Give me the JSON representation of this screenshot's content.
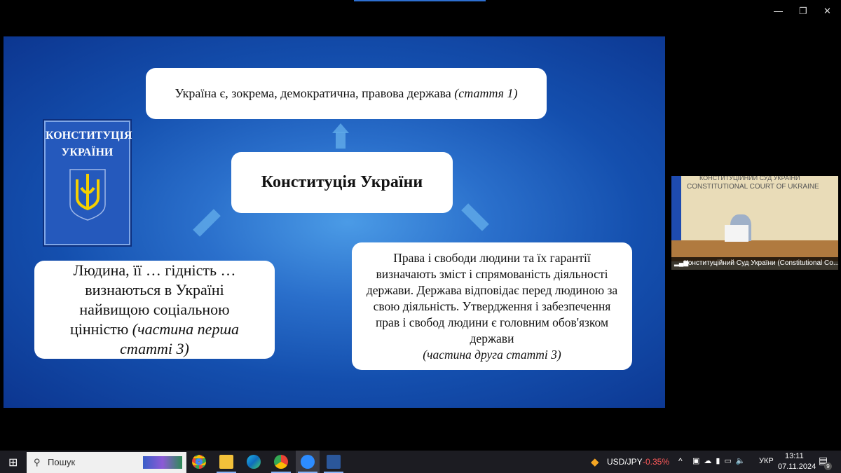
{
  "window": {
    "minimize": "—",
    "restore": "❐",
    "close": "✕"
  },
  "slide": {
    "top_box": {
      "text": "Україна є, зокрема, демократична, правова держава ",
      "ref": "(стаття 1)"
    },
    "center_box": "Конституція України",
    "left_box": {
      "text": "Людина, її … гідність … визнаються в Україні найвищою соціальною цінністю ",
      "ref": "(частина перша статті 3)"
    },
    "right_box": {
      "text": "Права і свободи людини та їх гарантії визначають зміст і спрямованість діяльності держави. Держава відповідає перед людиною за свою діяльність. Утвердження і забезпечення прав і свобод людини є головним обов'язком держави",
      "ref": "(частина друга статті 3)"
    },
    "book": {
      "title1": "КОНСТИТУЦІЯ",
      "title2": "УКРАЇНИ"
    }
  },
  "video": {
    "wall_title1": "КОНСТИТУЦІЙНИЙ СУД УКРАЇНИ",
    "wall_title2": "CONSTITUTIONAL COURT OF UKRAINE",
    "participant": "Конституційний Суд України (Constitutional Co..."
  },
  "taskbar": {
    "search": "Пошук",
    "ticker": "USD/JPY",
    "change": "-0.35%",
    "lang": "УКР",
    "time": "13:11",
    "date": "07.11.2024",
    "notifications": "9",
    "colors": {
      "negative": "#ff5a5a"
    }
  }
}
